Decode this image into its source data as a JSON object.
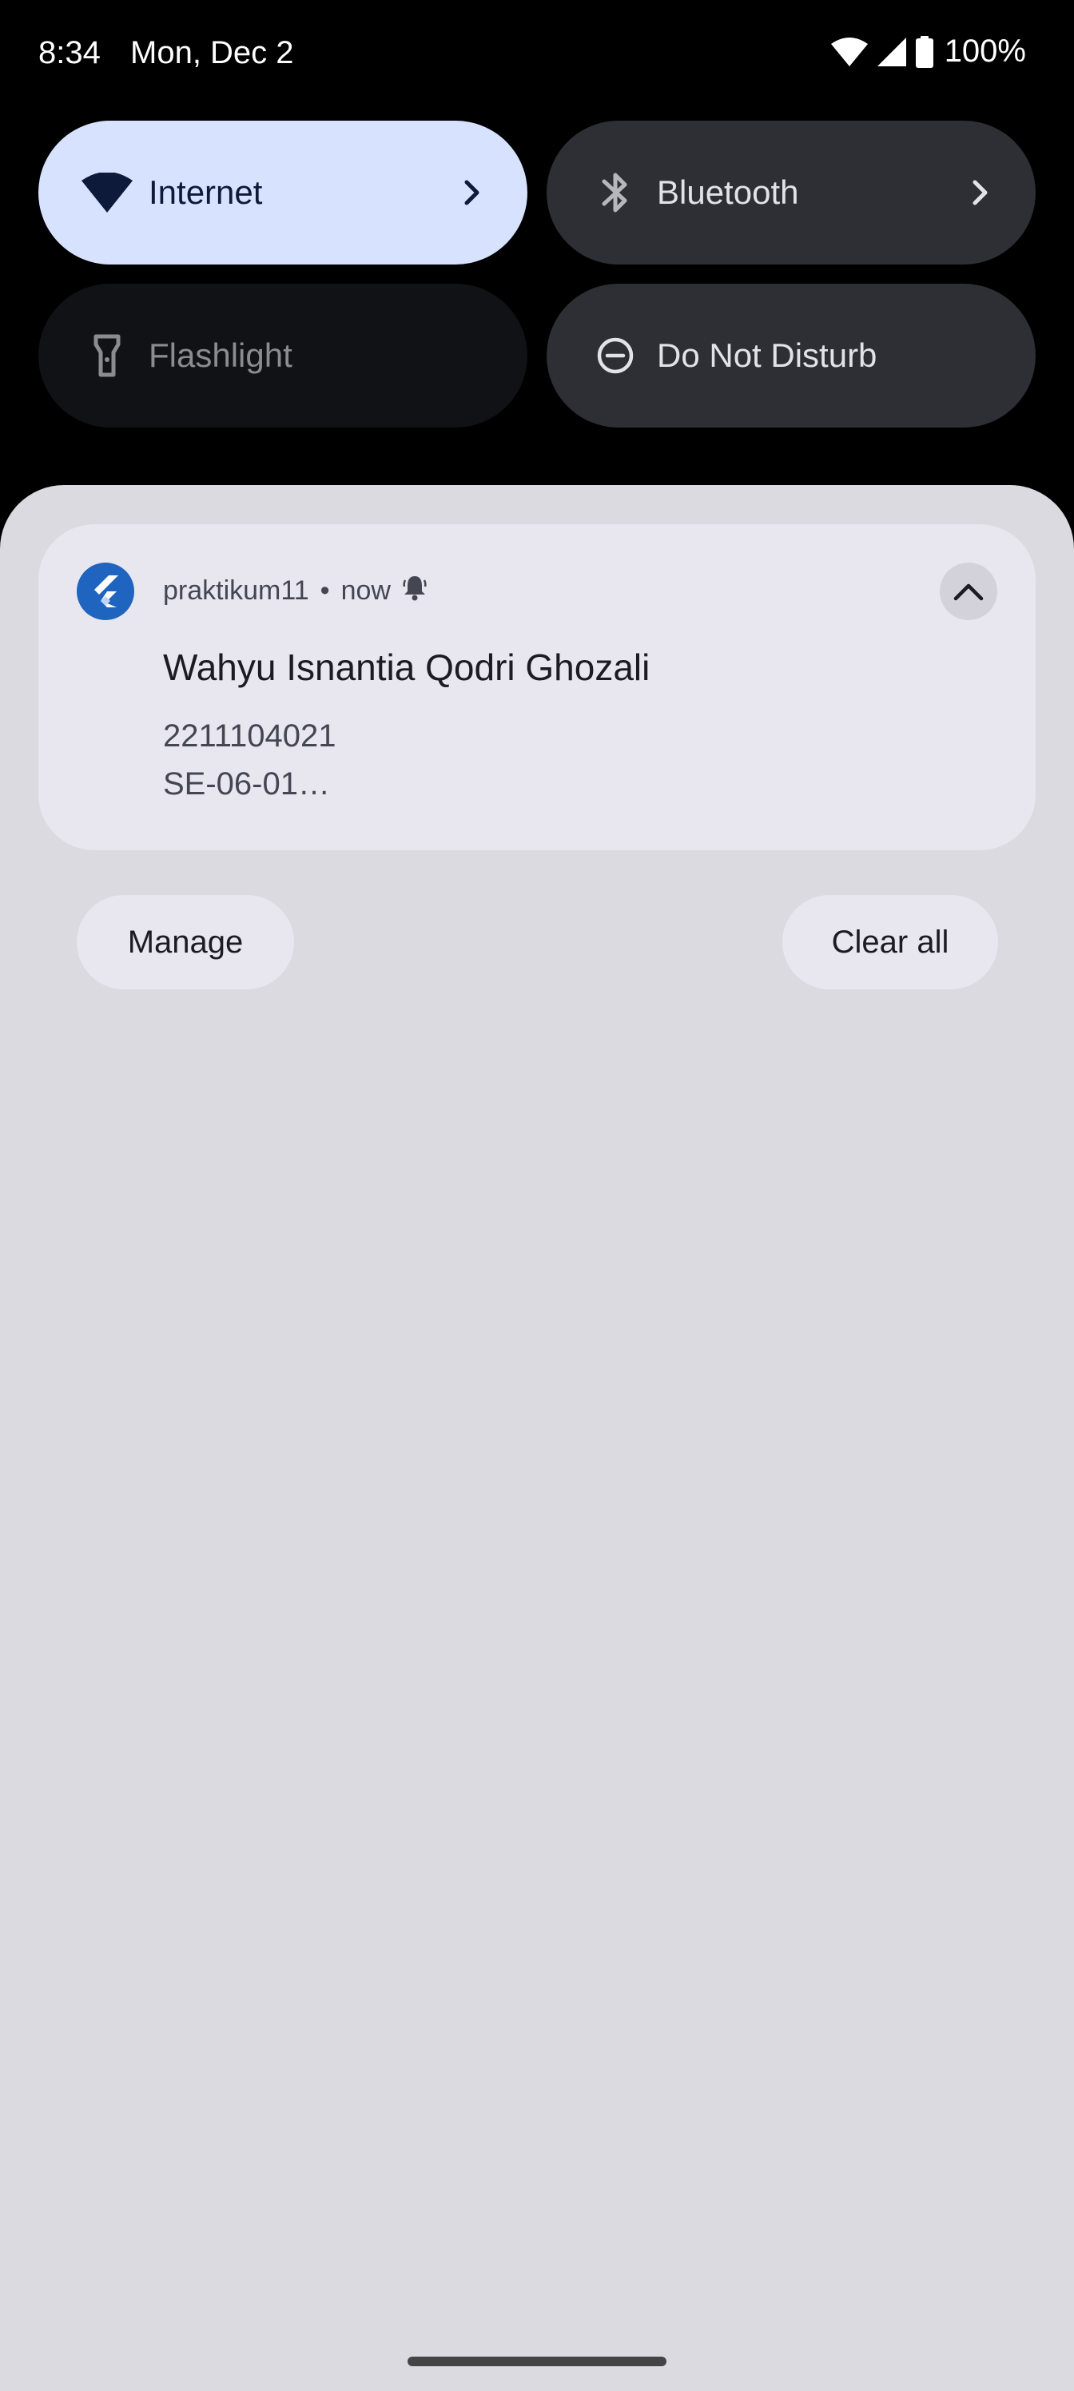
{
  "status_bar": {
    "time": "8:34",
    "date": "Mon, Dec 2",
    "battery": "100%",
    "icons": [
      "wifi-icon",
      "cell-signal-icon",
      "battery-icon"
    ]
  },
  "quick_settings": {
    "tiles": [
      {
        "label": "Internet",
        "icon": "wifi-icon",
        "state": "on",
        "has_chevron": true
      },
      {
        "label": "Bluetooth",
        "icon": "bluetooth-icon",
        "state": "off",
        "has_chevron": true
      },
      {
        "label": "Flashlight",
        "icon": "flashlight-icon",
        "state": "unavailable",
        "has_chevron": false
      },
      {
        "label": "Do Not Disturb",
        "icon": "do-not-disturb-icon",
        "state": "off",
        "has_chevron": false
      }
    ]
  },
  "notification": {
    "app_name": "praktikum11",
    "separator": "•",
    "time": "now",
    "app_icon": "flutter-logo-icon",
    "alert_icon": "bell-icon",
    "title": "Wahyu Isnantia Qodri Ghozali",
    "lines": [
      "2211104021",
      "SE-06-01…"
    ]
  },
  "actions": {
    "manage_label": "Manage",
    "clear_all_label": "Clear all"
  },
  "colors": {
    "background": "#000000",
    "active_tile": "#d7e2ff",
    "inactive_tile": "#2e2f34",
    "shade": "#dbdae0",
    "card": "#e8e7ef",
    "flutter_blue": "#1f65c0"
  }
}
